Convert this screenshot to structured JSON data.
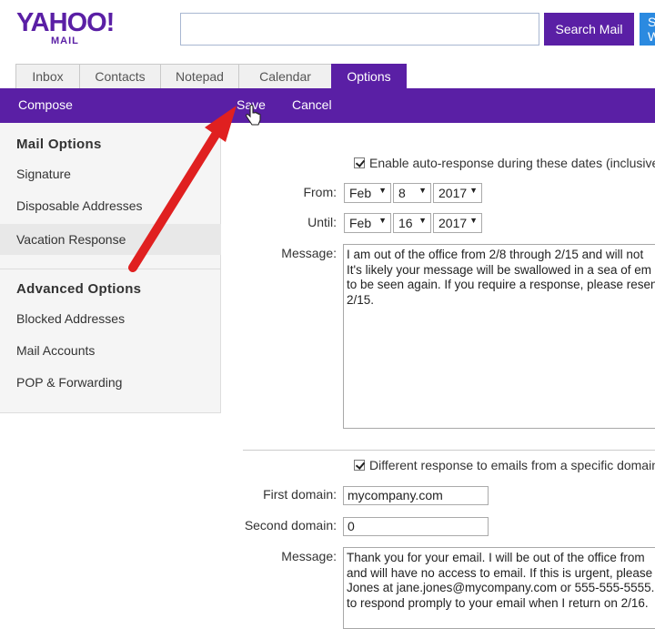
{
  "header": {
    "logo_text": "YAHOO!",
    "logo_sub": "MAIL",
    "search_placeholder": "",
    "search_mail_label": "Search Mail",
    "search_web_label": "Search Web"
  },
  "tabs": [
    {
      "label": "Inbox"
    },
    {
      "label": "Contacts"
    },
    {
      "label": "Notepad"
    },
    {
      "label": "Calendar"
    },
    {
      "label": "Options",
      "active": true
    }
  ],
  "toolbar": {
    "compose_label": "Compose",
    "save_label": "Save",
    "cancel_label": "Cancel"
  },
  "sidebar": {
    "mail_options_heading": "Mail Options",
    "mail_options_items": [
      {
        "label": "Signature"
      },
      {
        "label": "Disposable Addresses"
      },
      {
        "label": "Vacation Response",
        "selected": true
      }
    ],
    "advanced_heading": "Advanced Options",
    "advanced_items": [
      {
        "label": "Blocked Addresses"
      },
      {
        "label": "Mail Accounts"
      },
      {
        "label": "POP & Forwarding"
      }
    ]
  },
  "vacation": {
    "enable_label": "Enable auto-response during these dates (inclusive)",
    "enable_checked": true,
    "from_label": "From:",
    "from_month": "Feb",
    "from_day": "8",
    "from_year": "2017",
    "until_label": "Until:",
    "until_month": "Feb",
    "until_day": "16",
    "until_year": "2017",
    "message_label": "Message:",
    "message_text": "I am out of the office from 2/8 through 2/15 and will not\nIt's likely your message will be swallowed in a sea of em\nto be seen again. If you require a response, please resen\n2/15.",
    "different_label": "Different response to emails from a specific domain",
    "different_checked": true,
    "first_domain_label": "First domain:",
    "first_domain_value": "mycompany.com",
    "second_domain_label": "Second domain:",
    "second_domain_value": "0",
    "message2_label": "Message:",
    "message2_text": "Thank you for your email. I will be out of the office from\nand will have no access to email. If this is urgent, please\nJones at jane.jones@mycompany.com or 555-555-5555.\nto respond promply to your email when I return on 2/16."
  },
  "colors": {
    "brand_purple": "#5a1fa5",
    "search_web_blue": "#2b8ae0",
    "annotation_red": "#e02020"
  }
}
